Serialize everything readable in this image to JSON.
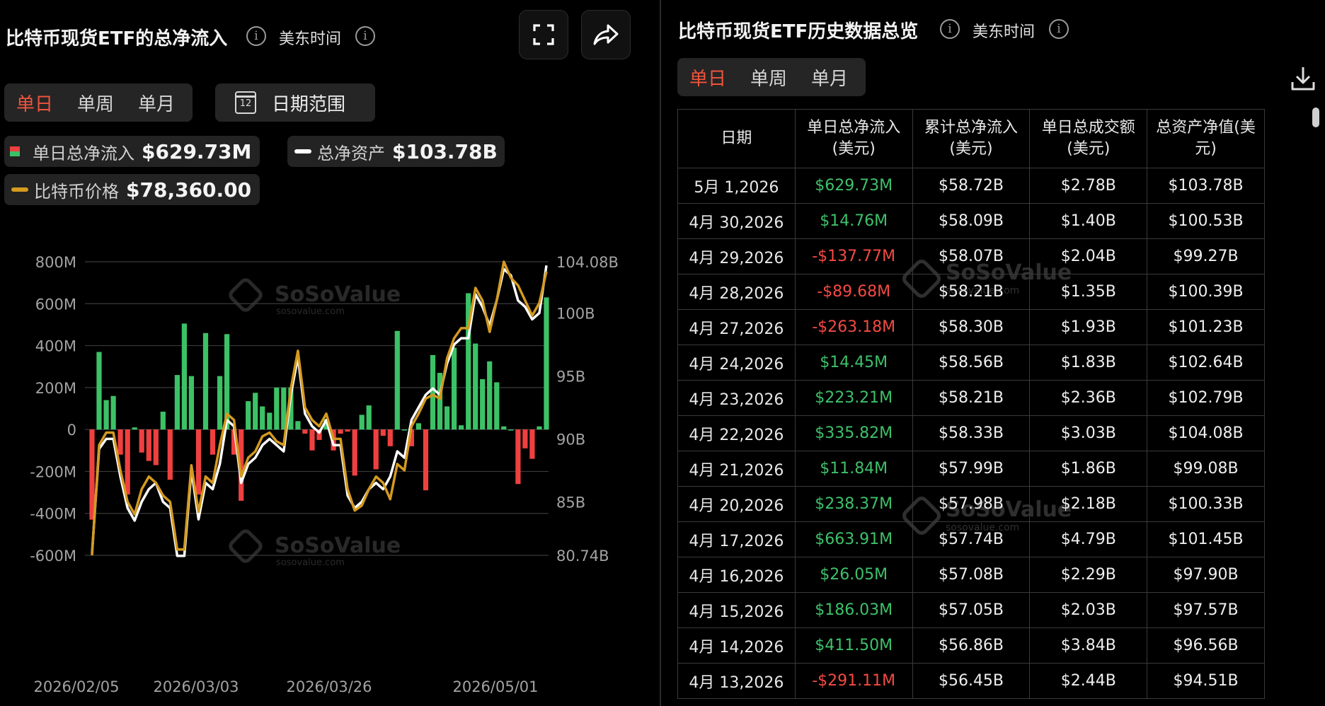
{
  "left": {
    "title": "比特币现货ETF的总净流入",
    "timezone": "美东时间",
    "tabs": [
      {
        "label": "单日",
        "active": true
      },
      {
        "label": "单周",
        "active": false
      },
      {
        "label": "单月",
        "active": false
      }
    ],
    "date_range_label": "日期范围",
    "calendar_day": "12",
    "legend": {
      "daily_flow_label": "单日总净流入",
      "daily_flow_value": "$629.73M",
      "net_assets_label": "总净资产",
      "net_assets_value": "$103.78B",
      "btc_price_label": "比特币价格",
      "btc_price_value": "$78,360.00"
    },
    "watermark": {
      "name": "SoSoValue",
      "url": "sosovalue.com"
    }
  },
  "chart_data": {
    "type": "bar",
    "y_left": {
      "ticks": [
        "800M",
        "600M",
        "400M",
        "200M",
        "0",
        "-200M",
        "-400M",
        "-600M"
      ],
      "range": [
        -600,
        800
      ],
      "unit": "M USD"
    },
    "y_right": {
      "ticks": [
        "104.08B",
        "100B",
        "95B",
        "90B",
        "85B",
        "80.74B"
      ],
      "range": [
        80.74,
        104.08
      ],
      "unit": "B USD"
    },
    "x_labels": [
      "2026/02/05",
      "2026/03/03",
      "2026/03/26",
      "2026/05/01"
    ],
    "colors": {
      "positive": "#3cc266",
      "negative": "#ef4040",
      "net_assets_line": "#ffffff",
      "btc_price_line": "#d49a1f"
    },
    "series": [
      {
        "name": "单日总净流入",
        "kind": "bar",
        "axis": "left",
        "values": [
          -430,
          370,
          140,
          160,
          -120,
          -310,
          10,
          -110,
          -150,
          -170,
          85,
          -240,
          260,
          505,
          255,
          -310,
          460,
          -120,
          255,
          455,
          -120,
          -340,
          135,
          175,
          110,
          80,
          200,
          200,
          200,
          40,
          -20,
          -100,
          -50,
          50,
          -100,
          -20,
          -10,
          -220,
          70,
          115,
          -190,
          -30,
          -80,
          470,
          0,
          -80,
          30,
          -290,
          355,
          270,
          110,
          390,
          20,
          650,
          410,
          240,
          325,
          225,
          15,
          0,
          -260,
          -90,
          -140,
          15,
          630
        ]
      },
      {
        "name": "总净资产",
        "kind": "line",
        "axis": "right",
        "values": [
          80.9,
          89.2,
          90,
          90,
          87,
          84.5,
          83.5,
          85,
          86,
          86.5,
          85,
          84.5,
          80.7,
          80.7,
          87.5,
          83.6,
          86.5,
          86,
          88,
          91.5,
          91,
          86.5,
          88,
          88.5,
          89.5,
          90,
          89.5,
          89,
          93.5,
          96.5,
          92,
          91,
          90.5,
          91.5,
          89.5,
          89.5,
          85.5,
          84.5,
          85,
          86,
          86.5,
          86,
          87,
          89,
          88.5,
          91.5,
          92.5,
          93.5,
          94,
          93.5,
          96,
          97.5,
          98,
          98,
          101.5,
          100.5,
          99,
          101,
          103.5,
          103,
          101,
          100.5,
          99.5,
          100,
          103.78
        ]
      },
      {
        "name": "比特币价格",
        "kind": "line",
        "axis": "right",
        "values": [
          80.74,
          89.5,
          90.5,
          90.5,
          87.5,
          85,
          84,
          86,
          87,
          86.5,
          85.5,
          85,
          81.2,
          81.2,
          87.9,
          84.2,
          87,
          86.5,
          89.5,
          92,
          91.5,
          87,
          88.5,
          89,
          90.2,
          90.5,
          89.8,
          89.5,
          94,
          97,
          92.5,
          91.5,
          91,
          92,
          90,
          90,
          86,
          84.3,
          84.7,
          86,
          87,
          86.5,
          85.2,
          88,
          87.5,
          91,
          92,
          93.2,
          93.5,
          93.2,
          96.4,
          98,
          98.8,
          98.8,
          102,
          101,
          98.5,
          101,
          104.08,
          102.8,
          102.2,
          101,
          99.8,
          100.8,
          103.3
        ]
      }
    ]
  },
  "right": {
    "title": "比特币现货ETF历史数据总览",
    "timezone": "美东时间",
    "tabs": [
      {
        "label": "单日",
        "active": true
      },
      {
        "label": "单周",
        "active": false
      },
      {
        "label": "单月",
        "active": false
      }
    ],
    "table": {
      "headers": [
        "日期",
        "单日总净流入\n(美元)",
        "累计总净流入\n(美元)",
        "单日总成交额\n(美元)",
        "总资产净值(美\n元)"
      ],
      "rows": [
        {
          "date": "5月 1,2026",
          "flow": "$629.73M",
          "dir": "pos",
          "cum": "$58.72B",
          "vol": "$2.78B",
          "nav": "$103.78B"
        },
        {
          "date": "4月 30,2026",
          "flow": "$14.76M",
          "dir": "pos",
          "cum": "$58.09B",
          "vol": "$1.40B",
          "nav": "$100.53B"
        },
        {
          "date": "4月 29,2026",
          "flow": "-$137.77M",
          "dir": "neg",
          "cum": "$58.07B",
          "vol": "$2.04B",
          "nav": "$99.27B"
        },
        {
          "date": "4月 28,2026",
          "flow": "-$89.68M",
          "dir": "neg",
          "cum": "$58.21B",
          "vol": "$1.35B",
          "nav": "$100.39B"
        },
        {
          "date": "4月 27,2026",
          "flow": "-$263.18M",
          "dir": "neg",
          "cum": "$58.30B",
          "vol": "$1.93B",
          "nav": "$101.23B"
        },
        {
          "date": "4月 24,2026",
          "flow": "$14.45M",
          "dir": "pos",
          "cum": "$58.56B",
          "vol": "$1.83B",
          "nav": "$102.64B"
        },
        {
          "date": "4月 23,2026",
          "flow": "$223.21M",
          "dir": "pos",
          "cum": "$58.21B",
          "vol": "$2.36B",
          "nav": "$102.79B"
        },
        {
          "date": "4月 22,2026",
          "flow": "$335.82M",
          "dir": "pos",
          "cum": "$58.33B",
          "vol": "$3.03B",
          "nav": "$104.08B"
        },
        {
          "date": "4月 21,2026",
          "flow": "$11.84M",
          "dir": "pos",
          "cum": "$57.99B",
          "vol": "$1.86B",
          "nav": "$99.08B"
        },
        {
          "date": "4月 20,2026",
          "flow": "$238.37M",
          "dir": "pos",
          "cum": "$57.98B",
          "vol": "$2.18B",
          "nav": "$100.33B"
        },
        {
          "date": "4月 17,2026",
          "flow": "$663.91M",
          "dir": "pos",
          "cum": "$57.74B",
          "vol": "$4.79B",
          "nav": "$101.45B"
        },
        {
          "date": "4月 16,2026",
          "flow": "$26.05M",
          "dir": "pos",
          "cum": "$57.08B",
          "vol": "$2.29B",
          "nav": "$97.90B"
        },
        {
          "date": "4月 15,2026",
          "flow": "$186.03M",
          "dir": "pos",
          "cum": "$57.05B",
          "vol": "$2.03B",
          "nav": "$97.57B"
        },
        {
          "date": "4月 14,2026",
          "flow": "$411.50M",
          "dir": "pos",
          "cum": "$56.86B",
          "vol": "$3.84B",
          "nav": "$96.56B"
        },
        {
          "date": "4月 13,2026",
          "flow": "-$291.11M",
          "dir": "neg",
          "cum": "$56.45B",
          "vol": "$2.44B",
          "nav": "$94.51B"
        }
      ]
    }
  }
}
